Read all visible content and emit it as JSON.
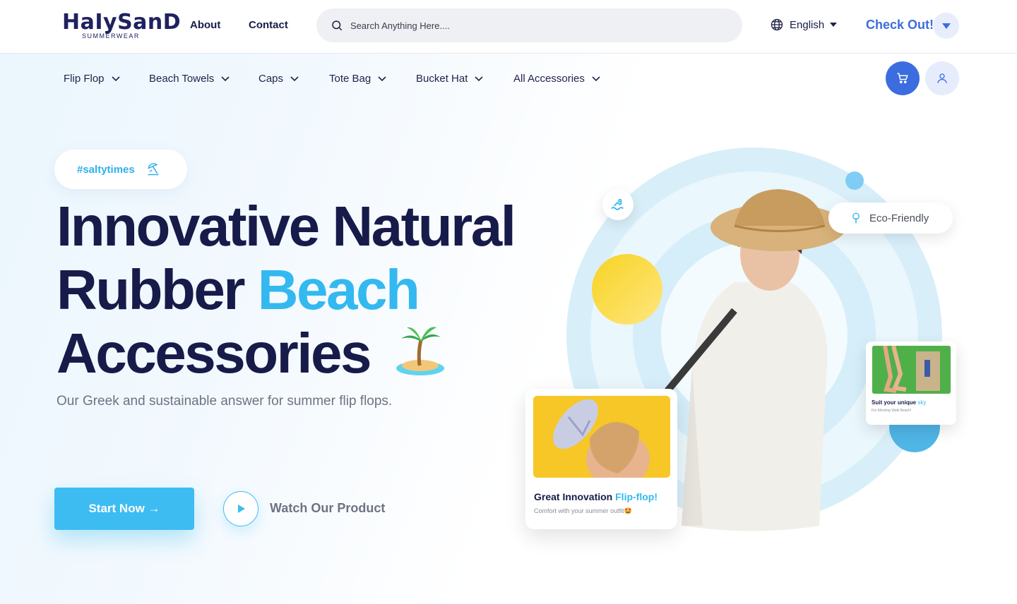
{
  "brand": {
    "logo_text": "HaIySanD",
    "logo_subtext": "SUMMERWEAR"
  },
  "topnav": {
    "links": [
      "About",
      "Contact"
    ],
    "search_placeholder": "Search Anything Here....",
    "language": "English",
    "checkout_label": "Check Out!"
  },
  "categories": [
    "Flip Flop",
    "Beach Towels",
    "Caps",
    "Tote Bag",
    "Bucket Hat",
    "All Accessories"
  ],
  "hero": {
    "hashtag": "#saltytimes",
    "headline_line1": "Innovative Natural",
    "headline_line2_a": "Rubber",
    "headline_line2_b": "Beach",
    "headline_line3": "Accessories",
    "subtitle": "Our Greek and sustainable answer for summer flip flops.",
    "start_button": "Start Now →",
    "watch_label": "Watch Our Product"
  },
  "badges": {
    "eco": "Eco-Friendly"
  },
  "cards": {
    "flipflop": {
      "title_a": "Great Innovation",
      "title_b": "Flip-flop!",
      "desc": "Comfort with your summer outfit🤩"
    },
    "bag": {
      "title_a": "Suit your unique",
      "title_b": "sky",
      "desc": "For Morning Walk Beach!"
    }
  },
  "colors": {
    "primary_dark": "#171b4a",
    "accent_sky": "#33b9ef",
    "button_blue": "#3b6de0",
    "checkout_blue": "#3d6ddb"
  }
}
